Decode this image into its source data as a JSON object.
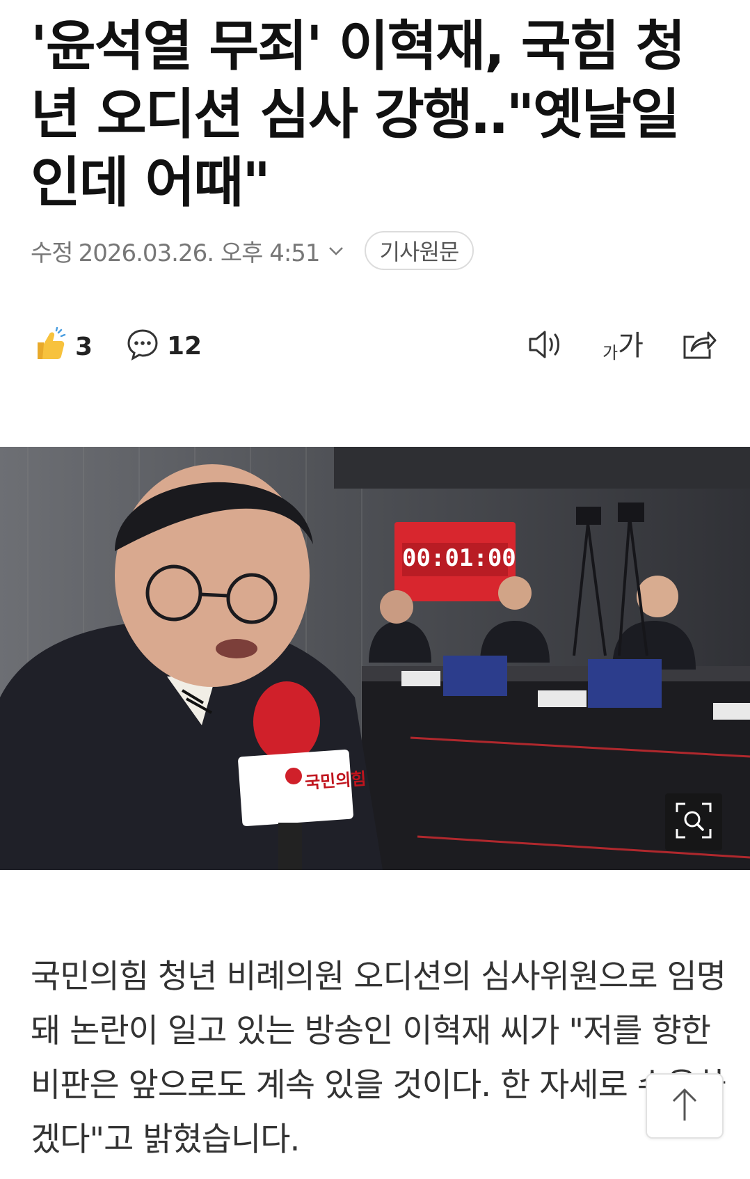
{
  "article": {
    "headline": "'윤석열 무죄' 이혁재, 국힘 청년 오디션 심사 강행‥\"옛날일인데 어때\"",
    "meta": {
      "label": "수정",
      "date": "2026.03.26. 오후 4:51",
      "source_button": "기사원문"
    },
    "actions": {
      "like_count": "3",
      "comment_count": "12",
      "font_size_label_small": "가",
      "font_size_label_large": "가"
    },
    "photo": {
      "timer": "00:01:00",
      "mic_brand": "국민의힘"
    },
    "body": "국민의힘 청년 비례의원 오디션의 심사위원으로 임명돼 논란이 일고 있는 방송인 이혁재 씨가 \"저를 향한 비판은 앞으로도 계속 있을 것이다. 한 자세로 수용하겠다\"고 밝혔습니다."
  },
  "icons": {
    "like": "thumbs-up-icon",
    "comment": "comment-bubble-icon",
    "tts": "speaker-icon",
    "font": "font-size-icon",
    "share": "share-icon",
    "zoom": "zoom-search-icon",
    "scroll_top": "arrow-up-icon"
  },
  "colors": {
    "timer_panel": "#d8262e",
    "mic_red": "#d0202a",
    "like_yellow": "#f7c23d"
  }
}
